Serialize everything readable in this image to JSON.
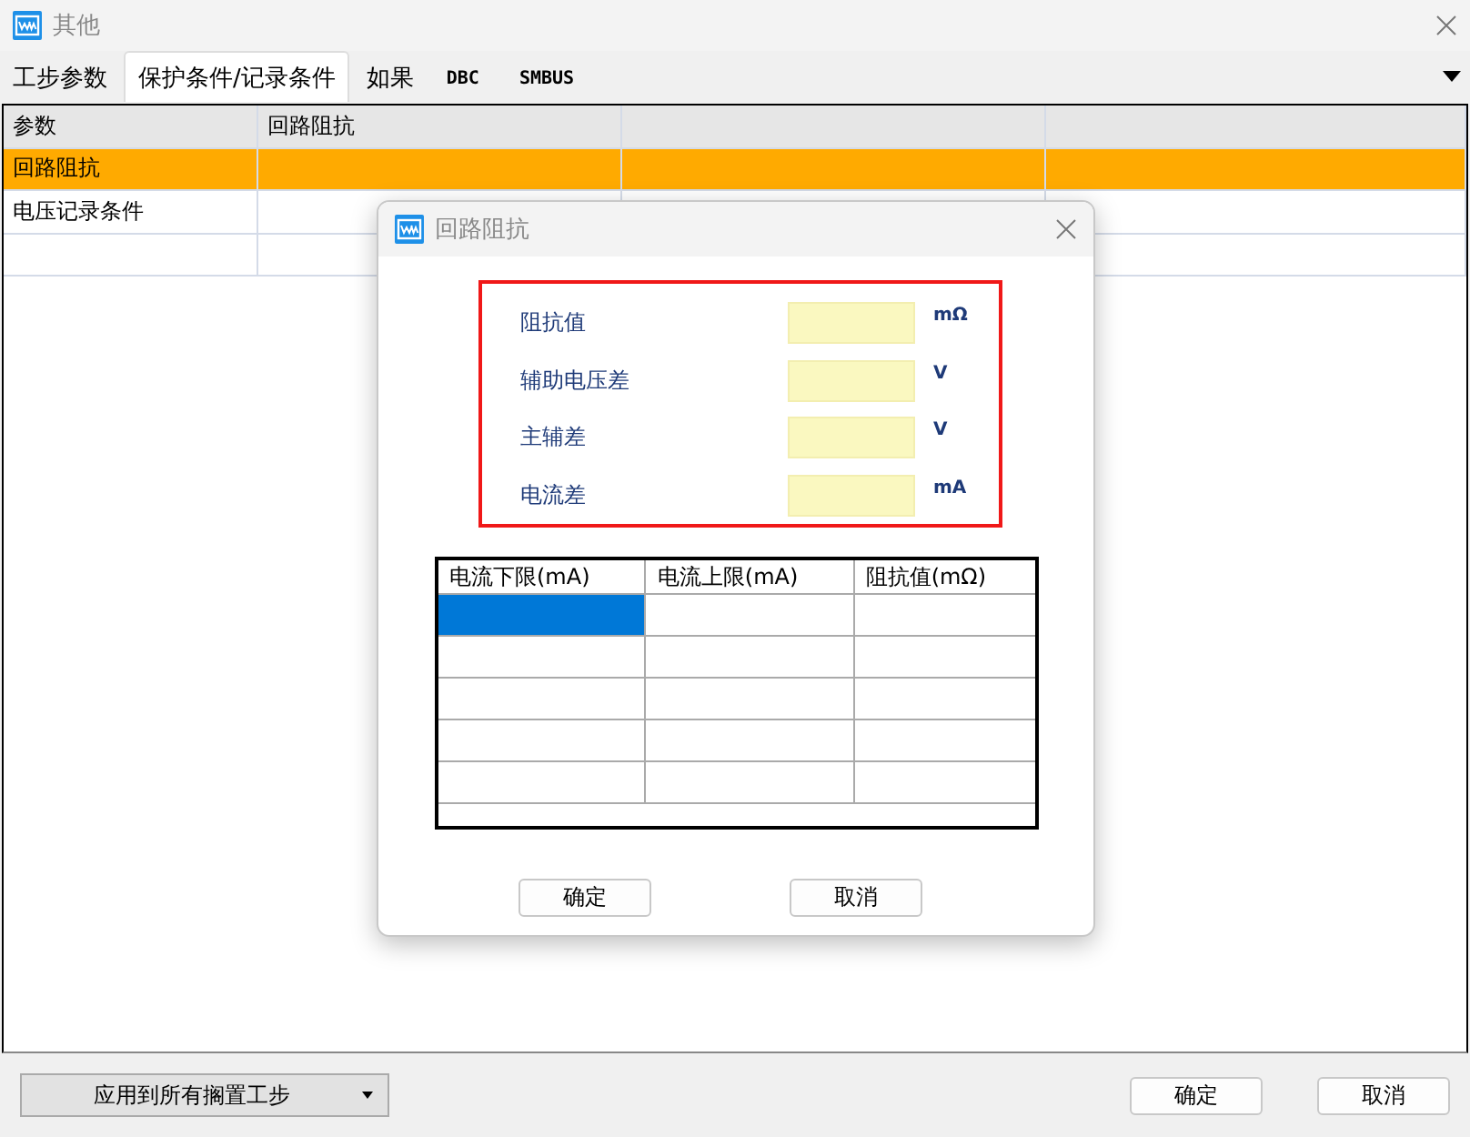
{
  "window": {
    "title": "其他"
  },
  "tabs": [
    {
      "label": "工步参数",
      "selected": false
    },
    {
      "label": "保护条件/记录条件",
      "selected": true
    },
    {
      "label": "如果",
      "selected": false
    },
    {
      "label": "DBC",
      "selected": false
    },
    {
      "label": "SMBUS",
      "selected": false
    }
  ],
  "grid": {
    "columns": [
      "参数",
      "回路阻抗"
    ],
    "rows": [
      {
        "name": "回路阻抗",
        "selected": true
      },
      {
        "name": "电压记录条件",
        "selected": false
      }
    ]
  },
  "dialog": {
    "title": "回路阻抗",
    "fields": [
      {
        "label": "阻抗值",
        "unit": "mΩ"
      },
      {
        "label": "辅助电压差",
        "unit": "V"
      },
      {
        "label": "主辅差",
        "unit": "V"
      },
      {
        "label": "电流差",
        "unit": "mA"
      }
    ],
    "table": {
      "columns": [
        "电流下限(mA)",
        "电流上限(mA)",
        "阻抗值(mΩ)"
      ],
      "rows": [
        {
          "selected": true
        },
        {
          "selected": false
        },
        {
          "selected": false
        },
        {
          "selected": false
        },
        {
          "selected": false
        }
      ]
    },
    "buttons": [
      "确定",
      "取消"
    ]
  },
  "footer": {
    "apply": "应用到所有搁置工步",
    "buttons": [
      "确定",
      "取消"
    ]
  }
}
